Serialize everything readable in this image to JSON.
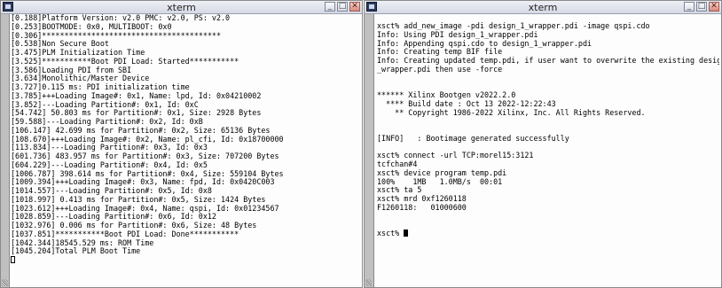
{
  "left_window": {
    "title": "xterm",
    "lines": [
      "[0.188]Platform Version: v2.0 PMC: v2.0, PS: v2.0",
      "[0.253]BOOTMODE: 0x0, MULTIBOOT: 0x0",
      "[0.306]****************************************",
      "[0.538]Non Secure Boot",
      "[3.475]PLM Initialization Time",
      "[3.525]***********Boot PDI Load: Started***********",
      "[3.586]Loading PDI from SBI",
      "[3.634]Monolithic/Master Device",
      "[3.727]0.115 ms: PDI initialization time",
      "[3.785]+++Loading Image#: 0x1, Name: lpd, Id: 0x04210002",
      "[3.852]---Loading Partition#: 0x1, Id: 0xC",
      "[54.742] 50.803 ms for Partition#: 0x1, Size: 2928 Bytes",
      "[59.588]---Loading Partition#: 0x2, Id: 0xB",
      "[106.147] 42.699 ms for Partition#: 0x2, Size: 65136 Bytes",
      "[108.670]+++Loading Image#: 0x2, Name: pl_cfi, Id: 0x18700000",
      "[113.834]---Loading Partition#: 0x3, Id: 0x3",
      "[601.736] 483.957 ms for Partition#: 0x3, Size: 707200 Bytes",
      "[604.229]---Loading Partition#: 0x4, Id: 0x5",
      "[1006.787] 398.614 ms for Partition#: 0x4, Size: 559104 Bytes",
      "[1009.394]+++Loading Image#: 0x3, Name: fpd, Id: 0x0420C003",
      "[1014.557]---Loading Partition#: 0x5, Id: 0x8",
      "[1018.997] 0.413 ms for Partition#: 0x5, Size: 1424 Bytes",
      "[1023.612]+++Loading Image#: 0x4, Name: qspi, Id: 0x01234567",
      "[1028.859]---Loading Partition#: 0x6, Id: 0x12",
      "[1032.976] 0.006 ms for Partition#: 0x6, Size: 48 Bytes",
      "[1037.851]***********Boot PDI Load: Done***********",
      "[1042.344]18545.529 ms: ROM Time",
      "[1045.204]Total PLM Boot Time"
    ]
  },
  "right_window": {
    "title": "xterm",
    "lines": [
      "xsct% add_new_image -pdi design_1_wrapper.pdi -image qspi.cdo",
      "Info: Using PDI design_1_wrapper.pdi",
      "Info: Appending qspi.cdo to design_1_wrapper.pdi",
      "Info: Creating temp BIF file",
      "Info: Creating updated temp.pdi, if user want to overwrite the existing design_1",
      "_wrapper.pdi then use -force",
      "",
      "",
      "****** Xilinx Bootgen v2022.2.0",
      "  **** Build date : Oct 13 2022-12:22:43",
      "    ** Copyright 1986-2022 Xilinx, Inc. All Rights Reserved.",
      "",
      "",
      "[INFO]   : Bootimage generated successfully",
      "",
      "xsct% connect -url TCP:morel15:3121",
      "tcfchan#4",
      "xsct% device program temp.pdi",
      "100%    1MB   1.0MB/s  00:01",
      "xsct% ta 5",
      "xsct% mrd 0xf1260118",
      "F1260118:   01000600",
      "",
      ""
    ],
    "prompt": "xsct% "
  }
}
